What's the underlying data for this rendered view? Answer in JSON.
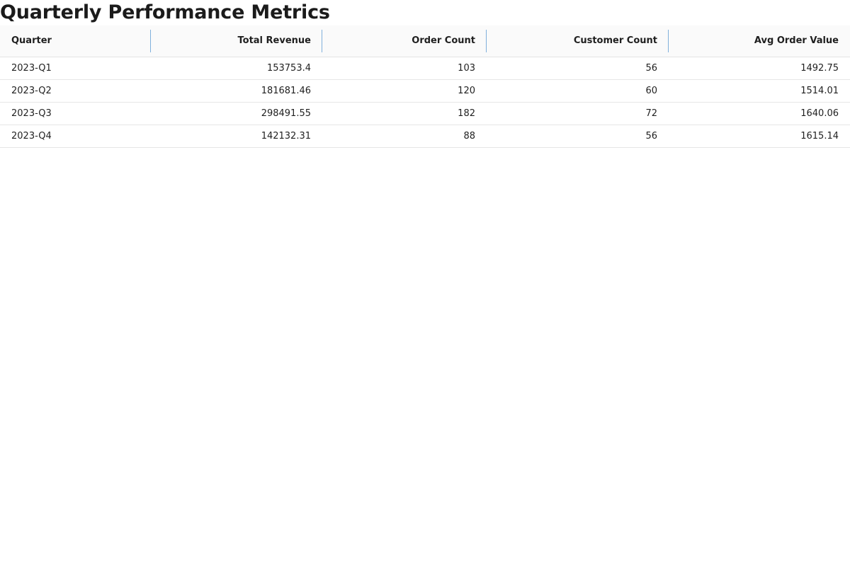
{
  "page": {
    "title": "Quarterly Performance Metrics"
  },
  "table": {
    "columns": [
      "Quarter",
      "Total Revenue",
      "Order Count",
      "Customer Count",
      "Avg Order Value"
    ],
    "rows": [
      [
        "2023-Q1",
        "153753.4",
        "103",
        "56",
        "1492.75"
      ],
      [
        "2023-Q2",
        "181681.46",
        "120",
        "60",
        "1514.01"
      ],
      [
        "2023-Q3",
        "298491.55",
        "182",
        "72",
        "1640.06"
      ],
      [
        "2023-Q4",
        "142132.31",
        "88",
        "56",
        "1615.14"
      ]
    ]
  },
  "colors": {
    "header_background": "#fafafa",
    "column_separator": "#7fb0dc",
    "row_border": "#e6e6e6"
  }
}
